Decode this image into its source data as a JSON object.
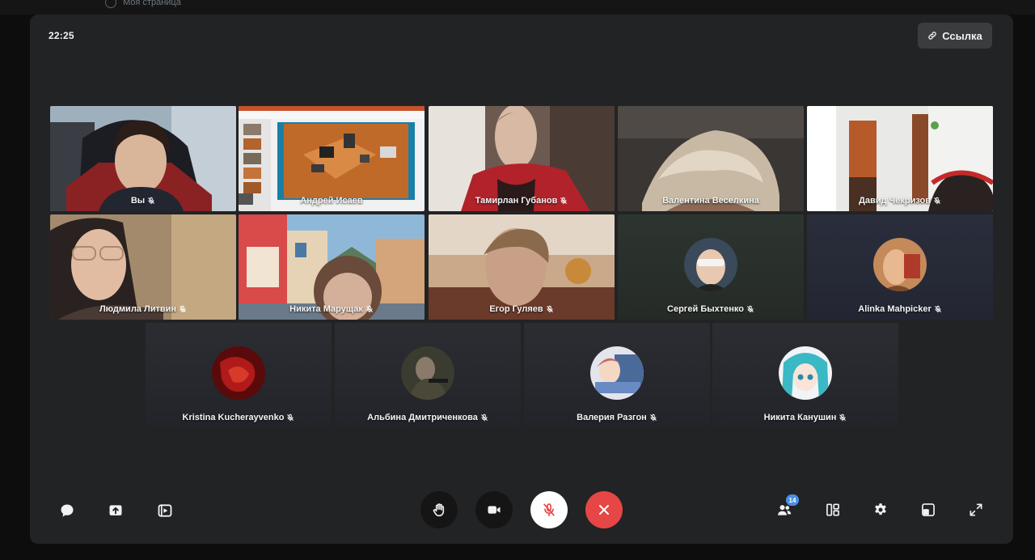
{
  "background": {
    "sidebar_item": "Моя страница"
  },
  "call": {
    "time": "22:25",
    "link_button": "Ссылка",
    "participant_count": "14"
  },
  "participants": [
    {
      "name": "Вы",
      "muted": true,
      "type": "video"
    },
    {
      "name": "Андрей Исаев",
      "muted": false,
      "type": "screen"
    },
    {
      "name": "Тамирлан Губанов",
      "muted": true,
      "type": "video"
    },
    {
      "name": "Валентина Веселкина",
      "muted": false,
      "type": "video"
    },
    {
      "name": "Давид Чекризов",
      "muted": true,
      "type": "video"
    },
    {
      "name": "Людмила Литвин",
      "muted": true,
      "type": "video"
    },
    {
      "name": "Никита Марущак",
      "muted": true,
      "type": "video"
    },
    {
      "name": "Егор Гуляев",
      "muted": true,
      "type": "video"
    },
    {
      "name": "Сергей Быхтенко",
      "muted": true,
      "type": "avatar"
    },
    {
      "name": "Alinka Mahpicker",
      "muted": true,
      "type": "avatar"
    },
    {
      "name": "Kristina Kucherayvenko",
      "muted": true,
      "type": "avatar"
    },
    {
      "name": "Альбина Дмитриченкова",
      "muted": true,
      "type": "avatar"
    },
    {
      "name": "Валерия Разгон",
      "muted": true,
      "type": "avatar"
    },
    {
      "name": "Никита Канушин",
      "muted": true,
      "type": "avatar"
    }
  ],
  "controls": {
    "left": [
      "chat-icon",
      "screen-share-icon",
      "stream-icon"
    ],
    "center": [
      "raise-hand-icon",
      "camera-icon",
      "mic-muted-icon",
      "end-call-icon"
    ],
    "right": [
      "participants-icon",
      "layout-icon",
      "settings-icon",
      "pip-icon",
      "fullscreen-icon"
    ]
  },
  "colors": {
    "window": "#222324",
    "end_call": "#e64646",
    "badge": "#4a8fe7"
  }
}
